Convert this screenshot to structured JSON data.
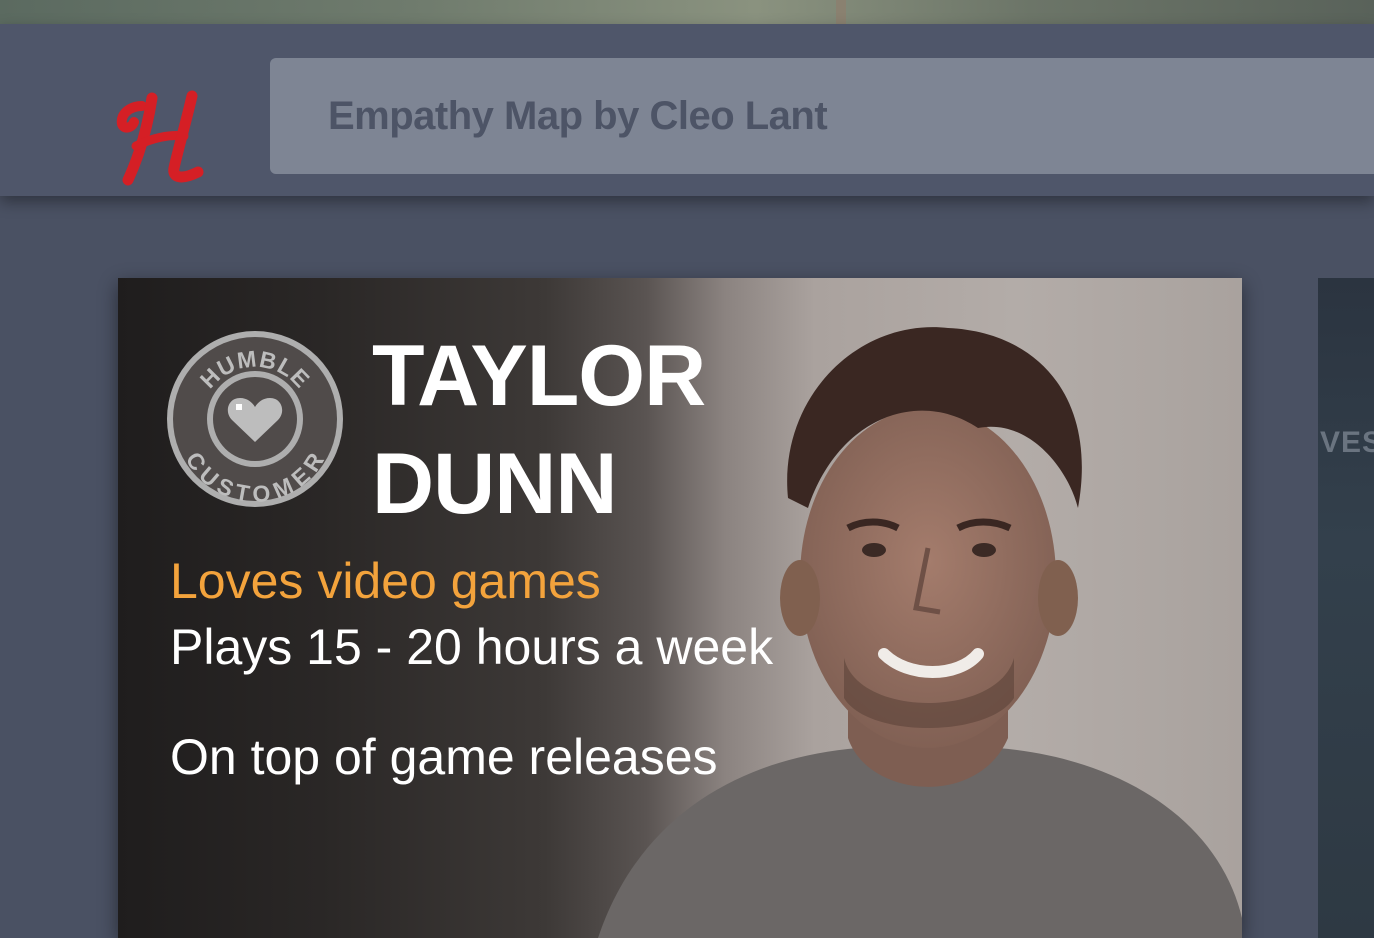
{
  "header": {
    "logo_alt": "Humble logo",
    "search_text": "Empathy Map by Cleo Lant"
  },
  "persona": {
    "badge_top_text": "HUMBLE",
    "badge_bottom_text": "CUSTOMER",
    "first_name": "TAYLOR",
    "last_name": "DUNN",
    "tagline": "Loves video games",
    "fact_1": "Plays 15 - 20 hours a week",
    "fact_2": "On top of game releases"
  },
  "next_card": {
    "partial_text": "VESC"
  },
  "colors": {
    "brand_red": "#d51f25",
    "accent_orange": "#f3a33c",
    "header_bg": "#4f566a",
    "search_bg": "#7e8594"
  },
  "icons": [
    "humble-logo-icon",
    "heart-icon"
  ]
}
